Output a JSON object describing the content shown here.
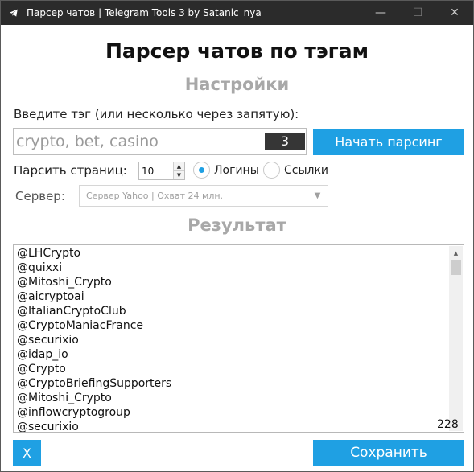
{
  "window": {
    "title": "Парсер чатов | Telegram Tools 3 by Satanic_nya",
    "icon": "telegram-icon",
    "controls": {
      "minimize": "—",
      "maximize": "☐",
      "close": "✕"
    }
  },
  "header": {
    "title": "Парсер чатов по тэгам",
    "settings_section": "Настройки",
    "result_section": "Результат"
  },
  "tag_input": {
    "prompt": "Введите тэг (или несколько через запятую):",
    "placeholder": "crypto, bet, casino",
    "count": "3"
  },
  "start_button": {
    "label": "Начать парсинг"
  },
  "pages": {
    "label": "Парсить страниц:",
    "value": "10"
  },
  "mode": {
    "options": [
      {
        "label": "Логины",
        "selected": true
      },
      {
        "label": "Ссылки",
        "selected": false
      }
    ]
  },
  "server": {
    "label": "Сервер:",
    "selected": "Сервер Yahoo | Охват 24 млн."
  },
  "results": {
    "items": [
      "@LHCrypto",
      "@quixxi",
      "@Mitoshi_Crypto",
      "@aicryptoai",
      "@ItalianCryptoClub",
      "@CryptoManiacFrance",
      "@securixio",
      "@idap_io",
      "@Crypto",
      "@CryptoBriefingSupporters",
      "@Mitoshi_Crypto",
      "@inflowcryptogroup",
      "@securixio"
    ],
    "count": "228"
  },
  "footer": {
    "close_label": "X",
    "save_label": "Сохранить"
  },
  "colors": {
    "accent": "#1fa0e3",
    "titlebar": "#2b2b2b",
    "section_heading": "#a8a8a8"
  }
}
